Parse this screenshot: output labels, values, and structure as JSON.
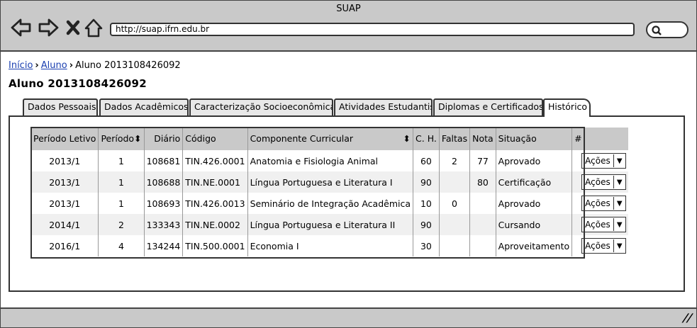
{
  "window": {
    "title": "SUAP"
  },
  "browser": {
    "url": "http://suap.ifrn.edu.br",
    "icons": [
      "back-arrow-icon",
      "forward-arrow-icon",
      "stop-icon",
      "home-icon",
      "search-icon"
    ]
  },
  "breadcrumb": {
    "items": [
      "Início",
      "Aluno",
      "Aluno 2013108426092"
    ]
  },
  "page": {
    "title": "Aluno 2013108426092"
  },
  "tabs": [
    "Dados Pessoais",
    "Dados Acadêmicos",
    "Caracterização Socioeconômica",
    "Atividades Estudantis",
    "Diplomas e Certificados",
    "Histórico"
  ],
  "table": {
    "headers": [
      "Período Letivo",
      "Período",
      "Diário",
      "Código",
      "Componente Curricular",
      "C. H.",
      "Faltas",
      "Nota",
      "Situação",
      "#"
    ],
    "rows": [
      [
        "2013/1",
        "1",
        "108681",
        "TIN.426.0001",
        "Anatomia e Fisiologia Animal",
        "60",
        "2",
        "77",
        "Aprovado",
        "Ações"
      ],
      [
        "2013/1",
        "1",
        "108688",
        "TIN.NE.0001",
        "Língua Portuguesa e Literatura I",
        "90",
        "",
        "80",
        "Certificação",
        "Ações"
      ],
      [
        "2013/1",
        "1",
        "108693",
        "TIN.426.0013",
        "Seminário de Integração Acadêmica",
        "10",
        "0",
        "",
        "Aprovado",
        "Ações"
      ],
      [
        "2014/1",
        "2",
        "133343",
        "TIN.NE.0002",
        "Língua Portuguesa e Literatura II",
        "90",
        "",
        "",
        "Cursando",
        "Ações"
      ],
      [
        "2016/1",
        "4",
        "134244",
        "TIN.500.0001",
        "Economia I",
        "30",
        "",
        "",
        "Aproveitamento",
        "Ações"
      ]
    ]
  }
}
